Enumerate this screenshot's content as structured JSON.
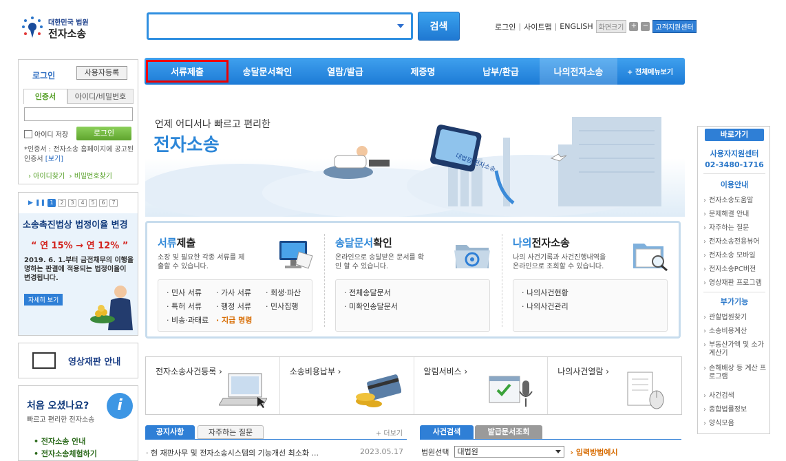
{
  "header": {
    "logo_line1": "대한민국 법원",
    "logo_line2": "전자소송",
    "search_button": "검색",
    "links": [
      "로그인",
      "사이트맵",
      "ENGLISH"
    ],
    "font_size_label": "화면크기",
    "plus": "+",
    "minus": "−",
    "support_center": "고객지원센터"
  },
  "nav": {
    "items": [
      "서류제출",
      "송달문서확인",
      "열람/발급",
      "제증명",
      "납부/환급",
      "나의전자소송"
    ],
    "all_menu": "+ 전체메뉴보기"
  },
  "login": {
    "title": "로그인",
    "register": "사용자등록",
    "tab_cert": "인증서",
    "tab_id": "아이디/비밀번호",
    "save_id": "아이디 저장",
    "login_button": "로그인",
    "note_prefix": "*인증서 : 전자소송 홈페이지에 공고된 인증서",
    "note_link": "[보기]",
    "find_id": "› 아이디찾기",
    "find_pw": "› 비밀번호찾기"
  },
  "promo": {
    "pages": [
      "1",
      "2",
      "3",
      "4",
      "5",
      "6",
      "7"
    ],
    "title": "소송촉진법상 법정이율 변경",
    "rate": "“ 연 15% → 연 12% ”",
    "description": "2019. 6. 1.부터 금전채무의 이행을 명하는 판결에 적용되는 법정이율이 변경됩니다.",
    "more": "자세히 보기"
  },
  "video": {
    "label": "영상재판 안내"
  },
  "first_visit": {
    "title": "처음 오셨나요?",
    "subtitle": "빠르고 편리한 전자소송",
    "links": [
      "• 전자소송 안내",
      "• 전자소송체험하기"
    ]
  },
  "hero": {
    "line1": "언제 어디서나 빠르고 편리한",
    "line2": "전자소송",
    "card_text": "대법원 전자소송"
  },
  "cards": [
    {
      "title_em": "서류",
      "title_rest": "제출",
      "desc": "소장 및 필요한 각종 서류를 제출할 수 있습니다.",
      "items": [
        "· 민사 서류",
        "· 가사 서류",
        "· 회생·파산",
        "· 특허 서류",
        "· 행정 서류",
        "· 민사집행",
        "· 비송·과태료",
        "· 지급 명령"
      ]
    },
    {
      "title_em": "송달문서",
      "title_rest": "확인",
      "desc": "온라인으로 송달받은 문서를 확인 할 수 있습니다.",
      "items": [
        "· 전체송달문서",
        "· 미확인송달문서"
      ]
    },
    {
      "title_em": "나의",
      "title_rest": "전자소송",
      "desc": "나의 사건기록과 사건진행내역을 온라인으로 조회할 수 있습니다.",
      "items": [
        "· 나의사건현황",
        "· 나의사건관리"
      ]
    }
  ],
  "shortcuts": [
    "전자소송사건등록 ›",
    "소송비용납부 ›",
    "알림서비스 ›",
    "나의사건열람 ›"
  ],
  "notices": {
    "tabs": [
      "공지사항",
      "자주하는 질문"
    ],
    "more": "+ 더보기",
    "items": [
      {
        "title": "· 현 재판사무 및 전자소송시스템의 기능개선 최소화 ...",
        "date": "2023.05.17"
      }
    ]
  },
  "case_search": {
    "tabs": [
      "사건검색",
      "발급문서조회"
    ],
    "court_label": "법원선택",
    "court_value": "대법원",
    "example": "› 입력방법예시"
  },
  "quick": {
    "title": "바로가기",
    "center_label": "사용자지원센터",
    "center_phone": "02-3480-1716",
    "section1": "이용안내",
    "links1": [
      "전자소송도움말",
      "문제해결 안내",
      "자주하는 질문",
      "전자소송전용뷰어",
      "전자소송 모바일",
      "전자소송PC버전",
      "영상재판 프로그램"
    ],
    "section2": "부가기능",
    "links2": [
      "관할법원찾기",
      "소송비용계산",
      "부동산가액 및 소가계산기",
      "손해배상 등 계산 프로그램",
      "사건검색",
      "종합법률정보",
      "양식모음"
    ]
  },
  "colors": {
    "primary": "#2f7fd6",
    "highlight": "#e00000",
    "green": "#58a12a",
    "orange": "#d76b00"
  }
}
